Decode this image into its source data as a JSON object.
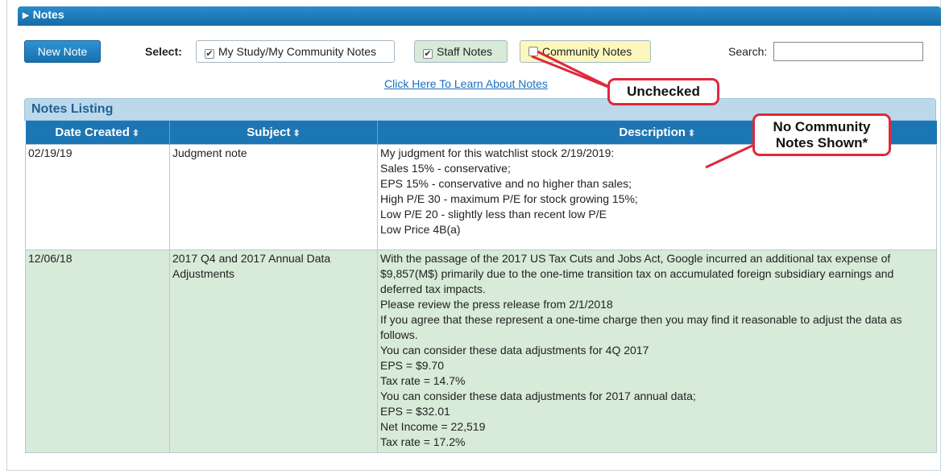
{
  "header": {
    "title": "Notes"
  },
  "toolbar": {
    "new_note_label": "New Note",
    "select_label": "Select:",
    "filters": [
      {
        "label": "My Study/My Community Notes",
        "checked": true
      },
      {
        "label": "Staff Notes",
        "checked": true
      },
      {
        "label": "Community Notes",
        "checked": false
      }
    ],
    "search_label": "Search:",
    "search_value": ""
  },
  "learn_link": "Click Here To Learn About Notes",
  "listing": {
    "title": "Notes Listing",
    "columns": [
      "Date Created",
      "Subject",
      "Description"
    ],
    "sort_icon": "⬍",
    "rows": [
      {
        "date": "02/19/19",
        "subject": "Judgment note",
        "description": [
          "My judgment for this watchlist stock 2/19/2019:",
          "Sales 15% - conservative;",
          "EPS 15% - conservative and no higher than sales;",
          "High P/E 30 - maximum P/E for stock growing 15%;",
          "Low P/E 20 - slightly less than recent low P/E",
          "Low Price 4B(a)"
        ]
      },
      {
        "date": "12/06/18",
        "subject": "2017 Q4 and 2017 Annual Data Adjustments",
        "description": [
          "With the passage of the 2017 US Tax Cuts and Jobs Act, Google incurred an additional tax expense of $9,857(M$) primarily due to the one-time transition tax on accumulated foreign subsidiary earnings and deferred tax impacts.",
          "Please review the press release from 2/1/2018",
          "If you agree that these represent a one-time charge then you may find it reasonable to adjust the data as follows.",
          "You can consider these data adjustments for 4Q 2017",
          "EPS = $9.70",
          "Tax rate = 14.7%",
          "You can consider these data adjustments for 2017 annual data;",
          "EPS = $32.01",
          "Net Income = 22,519",
          "Tax rate = 17.2%"
        ]
      }
    ]
  },
  "annotations": {
    "unchecked": "Unchecked",
    "no_community_line1": "No Community",
    "no_community_line2": "Notes Shown*"
  },
  "colors": {
    "header_blue": "#1d76b4",
    "staff_green": "#d8ead8",
    "community_yellow": "#fbf7bd",
    "callout_red": "#e0283c",
    "link_blue": "#1a6fc0"
  }
}
